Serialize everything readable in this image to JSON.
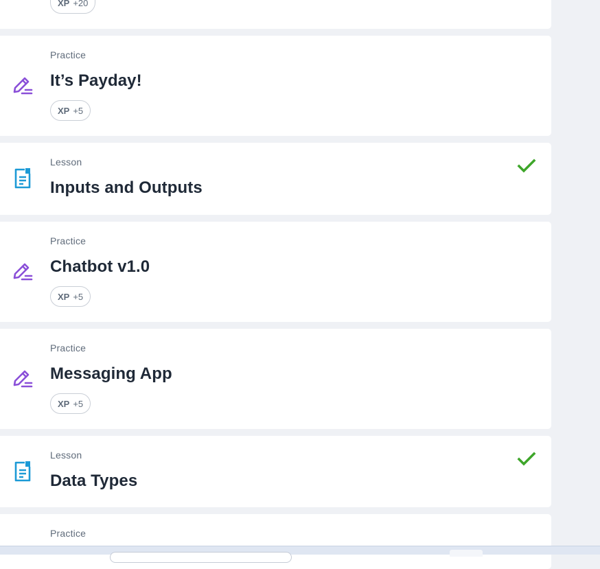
{
  "colors": {
    "practice_icon": "#8a4fd8",
    "lesson_icon": "#1c9ad6",
    "check": "#3ea62a",
    "page_bg": "#eff1f5"
  },
  "cards": [
    {
      "xp_label": "XP",
      "xp_value": "+20"
    },
    {
      "type": "Practice",
      "title": "It’s Payday!",
      "xp_label": "XP",
      "xp_value": "+5",
      "icon": "pencil-icon"
    },
    {
      "type": "Lesson",
      "title": "Inputs and Outputs",
      "icon": "document-icon",
      "completed": true
    },
    {
      "type": "Practice",
      "title": "Chatbot v1.0",
      "xp_label": "XP",
      "xp_value": "+5",
      "icon": "pencil-icon"
    },
    {
      "type": "Practice",
      "title": "Messaging App",
      "xp_label": "XP",
      "xp_value": "+5",
      "icon": "pencil-icon"
    },
    {
      "type": "Lesson",
      "title": "Data Types",
      "icon": "document-icon",
      "completed": true
    },
    {
      "type": "Practice"
    }
  ]
}
